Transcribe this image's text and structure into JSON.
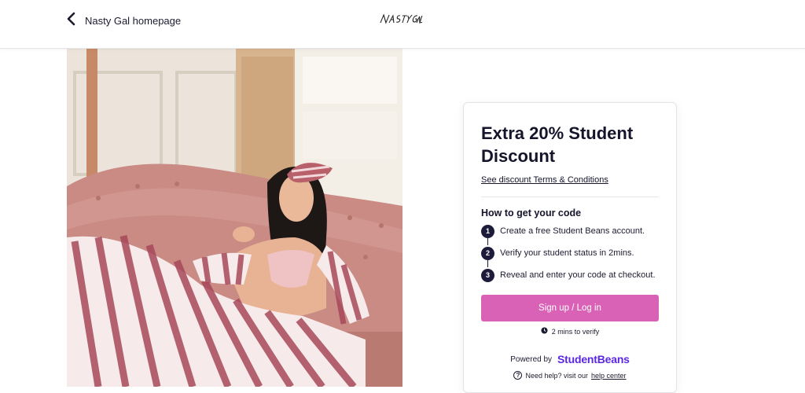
{
  "header": {
    "back_label": "Nasty Gal homepage",
    "logo_text": "NASTY GAL"
  },
  "hero": {
    "image_desc": "photo"
  },
  "card": {
    "title": "Extra 20% Student Discount",
    "terms_link": "See discount Terms & Conditions",
    "how_title": "How to get your code",
    "steps": [
      {
        "num": "1",
        "text": "Create a free Student Beans account."
      },
      {
        "num": "2",
        "text": "Verify your student status in 2mins."
      },
      {
        "num": "3",
        "text": "Reveal and enter your code at checkout."
      }
    ],
    "cta_label": "Sign up / Log in",
    "verify_note": "2 mins to verify",
    "powered_label": "Powered by",
    "brand": "StudentBeans",
    "help_prefix": "Need help? visit our",
    "help_link": "help center"
  },
  "colors": {
    "cta": "#d962b6",
    "brand": "#5b27e0",
    "step_badge": "#1c1c3a"
  }
}
